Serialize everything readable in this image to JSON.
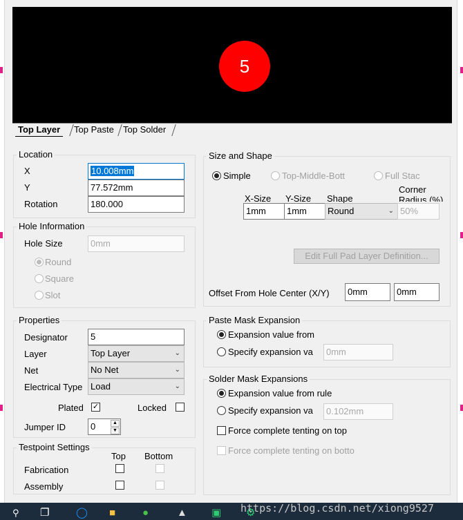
{
  "preview": {
    "pad_designator": "5"
  },
  "tabs": [
    "Top Layer",
    "Top Paste",
    "Top Solder"
  ],
  "location": {
    "title": "Location",
    "x_label": "X",
    "x_value": "10.008mm",
    "y_label": "Y",
    "y_value": "77.572mm",
    "rotation_label": "Rotation",
    "rotation_value": "180.000"
  },
  "hole": {
    "title": "Hole Information",
    "size_label": "Hole Size",
    "size_value": "0mm",
    "shapes": [
      "Round",
      "Square",
      "Slot"
    ]
  },
  "properties": {
    "title": "Properties",
    "designator_label": "Designator",
    "designator_value": "5",
    "layer_label": "Layer",
    "layer_value": "Top Layer",
    "net_label": "Net",
    "net_value": "No Net",
    "electrical_label": "Electrical Type",
    "electrical_value": "Load",
    "plated_label": "Plated",
    "plated_checked": true,
    "locked_label": "Locked",
    "locked_checked": false,
    "jumper_label": "Jumper ID",
    "jumper_value": "0"
  },
  "testpoint": {
    "title": "Testpoint Settings",
    "top_label": "Top",
    "bottom_label": "Bottom",
    "rows": [
      "Fabrication",
      "Assembly"
    ]
  },
  "size_shape": {
    "title": "Size and Shape",
    "mode_simple": "Simple",
    "mode_tmb": "Top-Middle-Bott",
    "mode_full": "Full Stac",
    "col_xsize": "X-Size",
    "col_ysize": "Y-Size",
    "col_shape": "Shape",
    "col_corner_1": "Corner",
    "col_corner_2": "Radius (%)",
    "xsize": "1mm",
    "ysize": "1mm",
    "shape": "Round",
    "corner": "50%",
    "edit_button": "Edit Full Pad Layer Definition...",
    "offset_label": "Offset From Hole Center (X/Y)",
    "offset_x": "0mm",
    "offset_y": "0mm"
  },
  "paste": {
    "title": "Paste Mask Expansion",
    "opt_rule": "Expansion value from",
    "opt_specify": "Specify expansion va",
    "value": "0mm"
  },
  "solder": {
    "title": "Solder Mask Expansions",
    "opt_rule": "Expansion value from rule",
    "opt_specify": "Specify expansion va",
    "value": "0.102mm",
    "tent_top": "Force complete tenting on top",
    "tent_bottom": "Force complete tenting on botto"
  },
  "watermark": "https://blog.csdn.net/xiong9527"
}
